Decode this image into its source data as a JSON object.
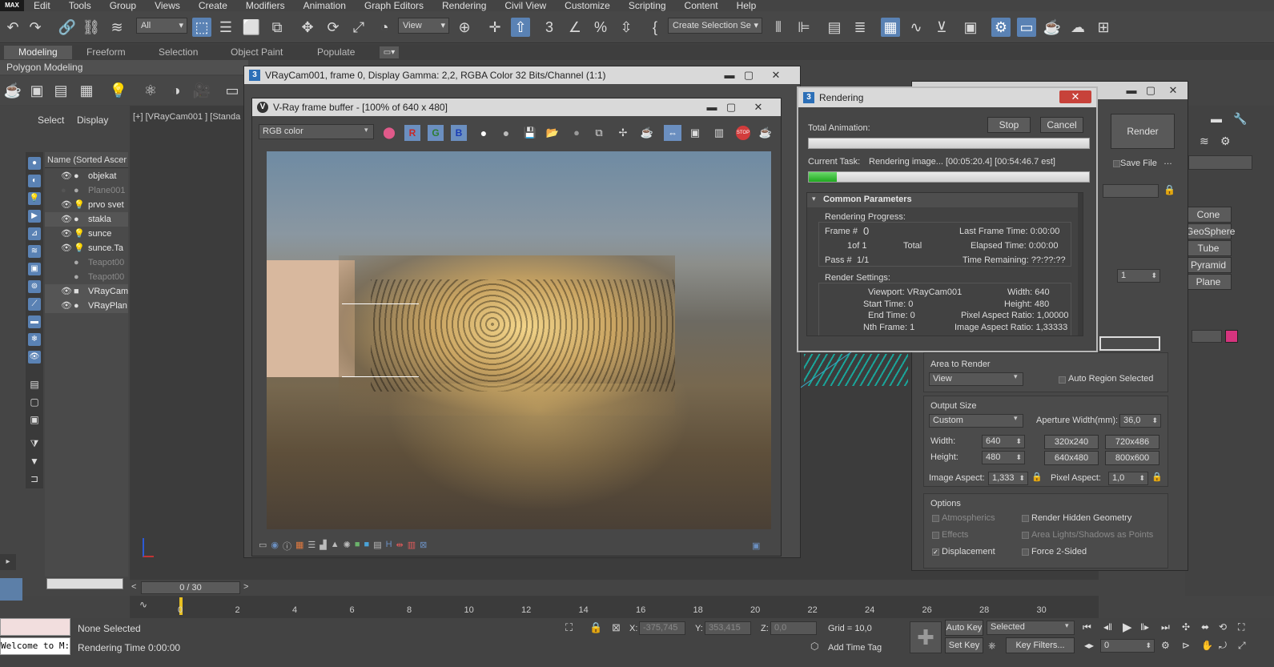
{
  "menu": [
    "Edit",
    "Tools",
    "Group",
    "Views",
    "Create",
    "Modifiers",
    "Animation",
    "Graph Editors",
    "Rendering",
    "Civil View",
    "Customize",
    "Scripting",
    "Content",
    "Help"
  ],
  "app_logo": "MAX",
  "toolbar": {
    "filter_value": "All",
    "view_value": "View",
    "selection_set_value": "Create Selection Se"
  },
  "ribbon": {
    "tabs": [
      "Modeling",
      "Freeform",
      "Selection",
      "Object Paint",
      "Populate"
    ],
    "subtitle": "Polygon Modeling"
  },
  "left_panel": {
    "tabs": [
      "Select",
      "Display"
    ],
    "header": "Name (Sorted Ascer",
    "items": [
      {
        "name": "objekat",
        "dim": false
      },
      {
        "name": "Plane001",
        "dim": true
      },
      {
        "name": "prvo svet",
        "dim": false
      },
      {
        "name": "stakla",
        "dim": false
      },
      {
        "name": "sunce",
        "dim": false
      },
      {
        "name": "sunce.Ta",
        "dim": false
      },
      {
        "name": "Teapot00",
        "dim": true
      },
      {
        "name": "Teapot00",
        "dim": true
      },
      {
        "name": "VRayCam",
        "dim": false
      },
      {
        "name": "VRayPlan",
        "dim": false
      }
    ]
  },
  "viewport_label": "[+] [VRayCam001 ] [Standa",
  "vray_outer": {
    "title": "VRayCam001, frame 0, Display Gamma: 2,2, RGBA Color 32 Bits/Channel (1:1)"
  },
  "vfb": {
    "title": "V-Ray frame buffer - [100% of 640 x 480]",
    "channel": "RGB color",
    "rgb_buttons": [
      "R",
      "G",
      "B"
    ]
  },
  "rendering_dialog": {
    "title": "Rendering",
    "total_animation_label": "Total Animation:",
    "stop_label": "Stop",
    "cancel_label": "Cancel",
    "current_task_label": "Current Task:",
    "current_task_value": "Rendering image... [00:05:20.4] [00:54:46.7 est]",
    "task_progress": 0.1,
    "section_title": "Common Parameters",
    "progress_title": "Rendering Progress:",
    "frame_label": "Frame #",
    "frame_value": "0",
    "of_label": "1of 1",
    "total_label": "Total",
    "pass_label": "Pass #",
    "pass_value": "1/1",
    "last_frame_time": "Last Frame Time: 0:00:00",
    "elapsed_time": "Elapsed Time: 0:00:00",
    "time_remaining": "Time Remaining: ??:??:??",
    "settings_title": "Render Settings:",
    "viewport": "Viewport: VRayCam001",
    "start_time": "Start Time: 0",
    "end_time": "End Time: 0",
    "nth_frame": "Nth Frame: 1",
    "width": "Width: 640",
    "height": "Height: 480",
    "pixel_aspect": "Pixel Aspect Ratio: 1,00000",
    "image_aspect": "Image Aspect Ratio: 1,33333"
  },
  "render_setup": {
    "render_label": "Render",
    "save_file_label": "Save File",
    "area_to_render_title": "Area to Render",
    "area_value": "View",
    "auto_region_label": "Auto Region Selected",
    "output_size_title": "Output Size",
    "output_preset": "Custom",
    "aperture_label": "Aperture Width(mm):",
    "aperture_value": "36,0",
    "width_label": "Width:",
    "width_value": "640",
    "height_label": "Height:",
    "height_value": "480",
    "presets": [
      "320x240",
      "720x486",
      "640x480",
      "800x600"
    ],
    "image_aspect_label": "Image Aspect:",
    "image_aspect_value": "1,333",
    "pixel_aspect_label": "Pixel Aspect:",
    "pixel_aspect_value": "1,0",
    "options_title": "Options",
    "options": [
      {
        "label": "Atmospherics",
        "checked": false,
        "dim": true
      },
      {
        "label": "Render Hidden Geometry",
        "checked": false,
        "dim": false
      },
      {
        "label": "Effects",
        "checked": false,
        "dim": true
      },
      {
        "label": "Area Lights/Shadows as Points",
        "checked": false,
        "dim": true
      },
      {
        "label": "Displacement",
        "checked": true,
        "dim": false
      },
      {
        "label": "Force 2-Sided",
        "checked": false,
        "dim": false
      }
    ]
  },
  "command_panel": {
    "objects": [
      "Cone",
      "GeoSphere",
      "Tube",
      "Pyramid",
      "Plane"
    ],
    "spinner_value": "1",
    "accent_color": "#d6347e"
  },
  "timeline": {
    "frame_counter": "0 / 30",
    "ticks": [
      "0",
      "2",
      "4",
      "6",
      "8",
      "10",
      "12",
      "14",
      "16",
      "18",
      "20",
      "22",
      "24",
      "26",
      "28",
      "30"
    ]
  },
  "status": {
    "listener": "Welcome to M:",
    "none_selected": "None Selected",
    "rendering_time": "Rendering Time  0:00:00",
    "x_label": "X:",
    "x_value": "-375,745",
    "y_label": "Y:",
    "y_value": "353,415",
    "z_label": "Z:",
    "z_value": "0,0",
    "grid": "Grid = 10,0",
    "add_time_tag": "Add Time Tag",
    "auto_key": "Auto Key",
    "selected": "Selected",
    "set_key": "Set Key",
    "key_filters": "Key Filters...",
    "frame_value": "0"
  }
}
